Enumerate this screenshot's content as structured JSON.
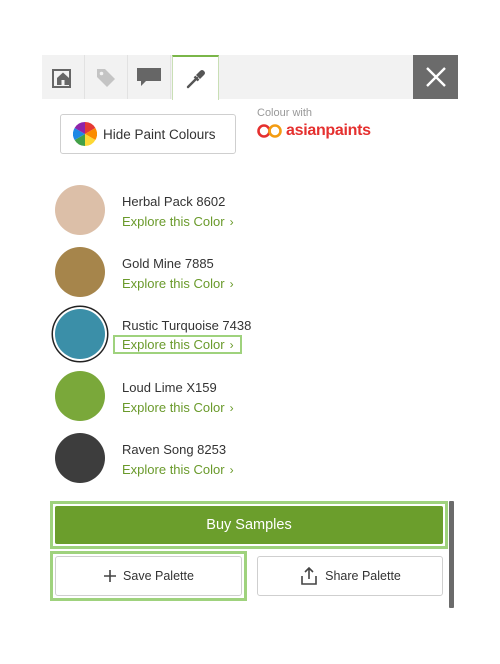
{
  "tabs": [
    {
      "icon": "home-icon",
      "label": ""
    },
    {
      "icon": "tag-icon",
      "label": ""
    },
    {
      "icon": "chat-icon",
      "label": ""
    },
    {
      "icon": "eyedropper-icon",
      "label": "",
      "active": true
    }
  ],
  "close_icon": "close-icon",
  "hide_button": {
    "label": "Hide Paint Colours",
    "icon": "color-wheel-icon"
  },
  "brand": {
    "caption": "Colour with",
    "name": "asianpaints",
    "color": "#e5302f"
  },
  "explore_label": "Explore this Color",
  "colors": [
    {
      "name": "Herbal Pack 8602",
      "hex": "#dcbfa8"
    },
    {
      "name": "Gold Mine 7885",
      "hex": "#a6854b"
    },
    {
      "name": "Rustic Turquoise 7438",
      "hex": "#3b8fa8",
      "selected": true
    },
    {
      "name": "Loud Lime X159",
      "hex": "#7aa83a"
    },
    {
      "name": "Raven Song 8253",
      "hex": "#3d3d3d"
    }
  ],
  "actions": {
    "buy": "Buy Samples",
    "save": "Save Palette",
    "share": "Share Palette"
  },
  "accent_color": "#6b9e2c",
  "highlight_color": "#9fd27d"
}
